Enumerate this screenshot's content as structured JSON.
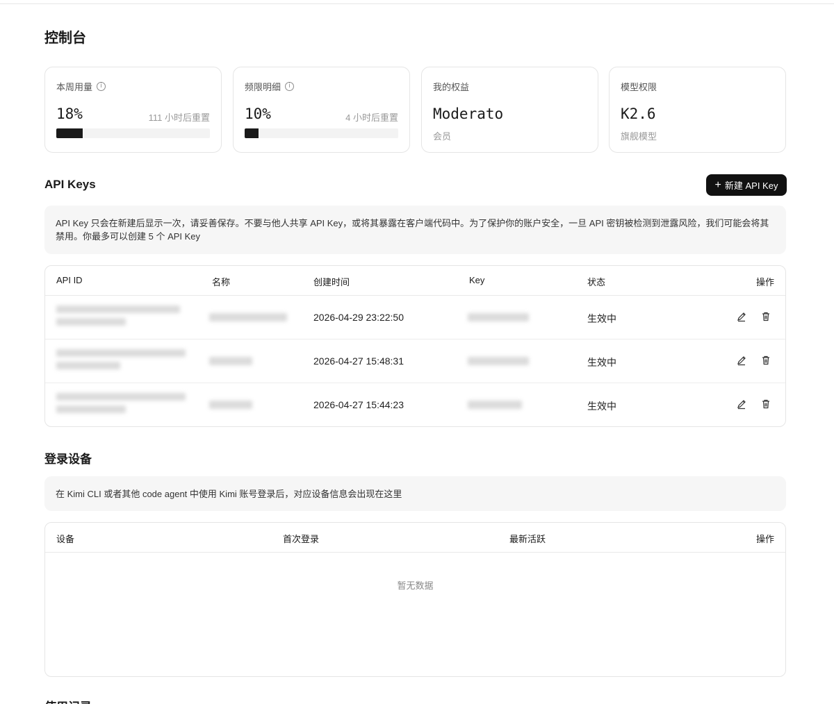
{
  "page": {
    "title": "控制台"
  },
  "cards": {
    "weekly_usage": {
      "label": "本周用量",
      "value": "18%",
      "reset": "111 小时后重置",
      "progress": 0.18
    },
    "rate_limit": {
      "label": "频限明细",
      "value": "10%",
      "reset": "4 小时后重置",
      "progress": 0.1
    },
    "benefits": {
      "label": "我的权益",
      "value": "Moderato",
      "sub": "会员"
    },
    "model": {
      "label": "模型权限",
      "value": "K2.6",
      "sub": "旗舰模型"
    }
  },
  "api_keys": {
    "title": "API Keys",
    "new_button": "新建 API Key",
    "notice": "API Key 只会在新建后显示一次，请妥善保存。不要与他人共享 API Key，或将其暴露在客户端代码中。为了保护你的账户安全，一旦 API 密钥被检测到泄露风险，我们可能会将其禁用。你最多可以创建 5 个 API Key",
    "columns": {
      "id": "API ID",
      "name": "名称",
      "created": "创建时间",
      "key": "Key",
      "status": "状态",
      "actions": "操作"
    },
    "rows": [
      {
        "created": "2026-04-29 23:22:50",
        "status": "生效中"
      },
      {
        "created": "2026-04-27 15:48:31",
        "status": "生效中"
      },
      {
        "created": "2026-04-27 15:44:23",
        "status": "生效中"
      }
    ]
  },
  "devices": {
    "title": "登录设备",
    "notice": "在 Kimi CLI 或者其他 code agent 中使用 Kimi 账号登录后，对应设备信息会出现在这里",
    "columns": {
      "device": "设备",
      "first_login": "首次登录",
      "last_active": "最新活跃",
      "actions": "操作"
    },
    "empty": "暂无数据"
  },
  "usage": {
    "title": "使用记录"
  }
}
